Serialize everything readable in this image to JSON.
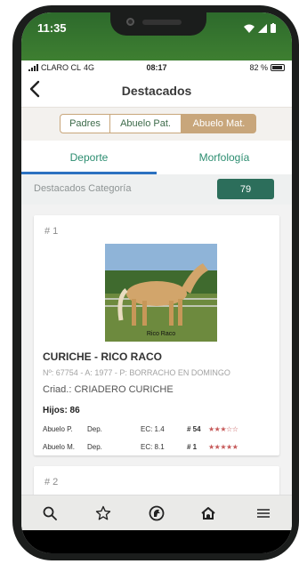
{
  "os_bar": {
    "time": "11:35"
  },
  "status_bar": {
    "carrier": "CLARO CL",
    "network": "4G",
    "clock": "08:17",
    "battery": "82 %"
  },
  "header": {
    "title": "Destacados"
  },
  "segments": [
    {
      "label": "Padres"
    },
    {
      "label": "Abuelo Pat."
    },
    {
      "label": "Abuelo Mat."
    }
  ],
  "tabs": [
    {
      "label": "Deporte"
    },
    {
      "label": "Morfología"
    }
  ],
  "category": {
    "label": "Destacados Categoría",
    "count": "79"
  },
  "cards": [
    {
      "rank": "# 1",
      "photo_caption": "Rico Raco",
      "name": "CURICHE - RICO RACO",
      "meta": "Nº: 67754 - A: 1977 - P: BORRACHO EN DOMINGO",
      "breeder": "Criad.: CRIADERO CURICHE",
      "hijos": "Hijos: 86",
      "rows": [
        {
          "name": "Abuelo P.",
          "dep": "Dep.",
          "ec": "EC: 1.4",
          "rank": "# 54",
          "stars": "★★★☆☆"
        },
        {
          "name": "Abuelo M.",
          "dep": "Dep.",
          "ec": "EC: 8.1",
          "rank": "# 1",
          "stars": "★★★★★"
        }
      ]
    },
    {
      "rank": "# 2"
    }
  ],
  "colors": {
    "os_bar_green": "#3e7f31",
    "segment_accent": "#c8a67b",
    "tab_text": "#2c8d70",
    "tab_indicator": "#2b71c0",
    "count_badge": "#2c6e5b",
    "stars": "#c65a5a"
  },
  "nav_icons": [
    "search-icon",
    "star-icon",
    "horse-logo-icon",
    "home-icon",
    "menu-icon"
  ]
}
